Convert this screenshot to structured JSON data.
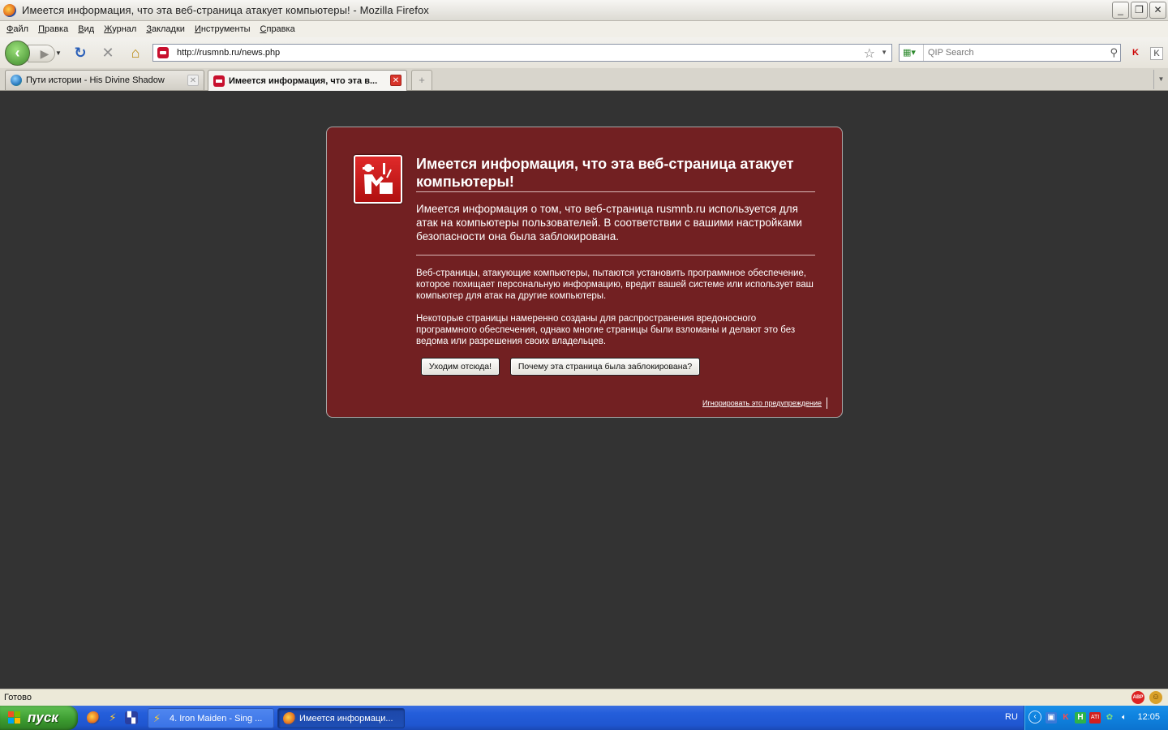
{
  "window": {
    "title": "Имеется информация, что эта веб-страница атакует компьютеры! - Mozilla Firefox",
    "minimize": "_",
    "restore": "❐",
    "close": "✕"
  },
  "menu": [
    "Файл",
    "Правка",
    "Вид",
    "Журнал",
    "Закладки",
    "Инструменты",
    "Справка"
  ],
  "toolbar": {
    "url": "http://rusmnb.ru/news.php",
    "search_placeholder": "QIP Search"
  },
  "tabs": [
    {
      "label": "Пути истории - His Divine Shadow",
      "active": false
    },
    {
      "label": "Имеется информация, что эта в...",
      "active": true
    }
  ],
  "warning": {
    "title": "Имеется информация, что эта веб-страница атакует компьютеры!",
    "short_desc": "Имеется информация о том, что веб-страница rusmnb.ru используется для атак на компьютеры пользователей. В соответствии с вашими настройками безопасности она была заблокирована.",
    "long_desc_1": "Веб-страницы, атакующие компьютеры, пытаются установить программное обеспечение, которое похищает персональную информацию, вредит вашей системе или использует ваш компьютер для атак на другие компьютеры.",
    "long_desc_2": "Некоторые страницы намеренно созданы для распространения вредоносного программного обеспечения, однако многие страницы были взломаны и делают это без ведома или разрешения своих владельцев.",
    "btn_leave": "Уходим отсюда!",
    "btn_why": "Почему эта страница была заблокирована?",
    "ignore": "Игнорировать это предупреждение"
  },
  "status": {
    "text": "Готово",
    "abp": "ABP"
  },
  "taskbar": {
    "start": "пуск",
    "tasks": [
      {
        "label": "4. Iron Maiden - Sing ..."
      },
      {
        "label": "Имеется информаци..."
      }
    ],
    "lang": "RU",
    "clock": "12:05"
  }
}
